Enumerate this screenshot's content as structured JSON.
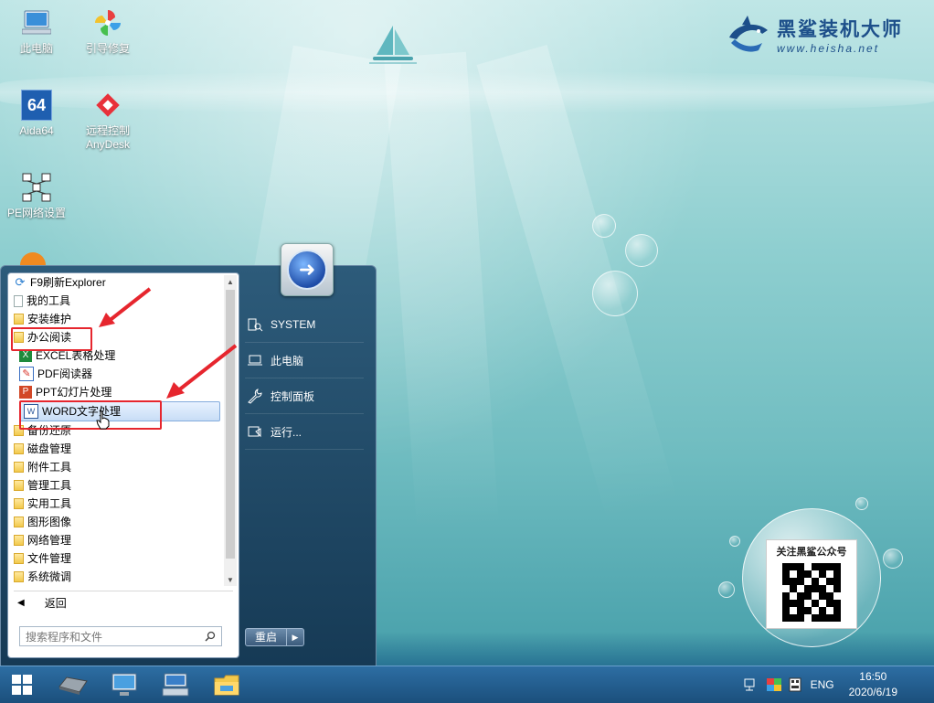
{
  "desktop": {
    "icons": [
      {
        "label": "此电脑"
      },
      {
        "label": "引导修复"
      },
      {
        "label": "Aida64",
        "badge": "64"
      },
      {
        "label": "远程控制",
        "label2": "AnyDesk"
      },
      {
        "label": "PE网络设置"
      }
    ]
  },
  "logo": {
    "brand": "黑鲨装机大师",
    "url": "www.heisha.net"
  },
  "qr": {
    "title": "关注黑鲨公众号"
  },
  "start_menu": {
    "items": [
      {
        "label": "F9刷新Explorer",
        "icon": "refresh-icon"
      },
      {
        "label": "我的工具",
        "icon": "document-icon"
      },
      {
        "label": "安装维护",
        "icon": "folder-icon"
      },
      {
        "label": "办公阅读",
        "icon": "folder-icon"
      },
      {
        "label": "EXCEL表格处理",
        "icon": "excel-icon"
      },
      {
        "label": "PDF阅读器",
        "icon": "pdf-icon"
      },
      {
        "label": "PPT幻灯片处理",
        "icon": "ppt-icon"
      },
      {
        "label": "WORD文字处理",
        "icon": "word-icon"
      },
      {
        "label": "备份还原",
        "icon": "folder-icon"
      },
      {
        "label": "磁盘管理",
        "icon": "folder-icon"
      },
      {
        "label": "附件工具",
        "icon": "folder-icon"
      },
      {
        "label": "管理工具",
        "icon": "folder-icon"
      },
      {
        "label": "实用工具",
        "icon": "folder-icon"
      },
      {
        "label": "图形图像",
        "icon": "folder-icon"
      },
      {
        "label": "网络管理",
        "icon": "folder-icon"
      },
      {
        "label": "文件管理",
        "icon": "folder-icon"
      },
      {
        "label": "系统微调",
        "icon": "folder-icon"
      }
    ],
    "back_label": "返回",
    "search_placeholder": "搜索程序和文件",
    "right": {
      "system": "SYSTEM",
      "this_pc": "此电脑",
      "control_panel": "控制面板",
      "run": "运行..."
    },
    "restart_label": "重启"
  },
  "taskbar": {
    "language": "ENG",
    "time": "16:50",
    "date": "2020/6/19"
  },
  "colors": {
    "accent": "#e6262e",
    "taskbar": "#1b4f7c",
    "menu": "#163a55"
  }
}
